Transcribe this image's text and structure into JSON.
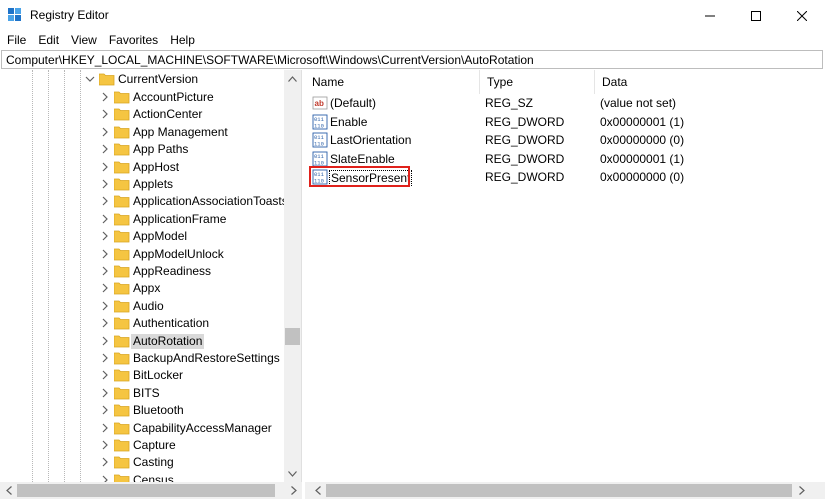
{
  "window": {
    "title": "Registry Editor",
    "icon": "registry-editor-icon"
  },
  "menu": [
    "File",
    "Edit",
    "View",
    "Favorites",
    "Help"
  ],
  "address": "Computer\\HKEY_LOCAL_MACHINE\\SOFTWARE\\Microsoft\\Windows\\CurrentVersion\\AutoRotation",
  "tree": {
    "parent": "CurrentVersion",
    "items": [
      "AccountPicture",
      "ActionCenter",
      "App Management",
      "App Paths",
      "AppHost",
      "Applets",
      "ApplicationAssociationToasts",
      "ApplicationFrame",
      "AppModel",
      "AppModelUnlock",
      "AppReadiness",
      "Appx",
      "Audio",
      "Authentication",
      "AutoRotation",
      "BackupAndRestoreSettings",
      "BitLocker",
      "BITS",
      "Bluetooth",
      "CapabilityAccessManager",
      "Capture",
      "Casting",
      "Census"
    ],
    "selected": "AutoRotation"
  },
  "values": {
    "columns": [
      "Name",
      "Type",
      "Data"
    ],
    "rows": [
      {
        "name": "(Default)",
        "type": "REG_SZ",
        "data": "(value not set)",
        "icon": "string-value-icon"
      },
      {
        "name": "Enable",
        "type": "REG_DWORD",
        "data": "0x00000001 (1)",
        "icon": "dword-value-icon"
      },
      {
        "name": "LastOrientation",
        "type": "REG_DWORD",
        "data": "0x00000000 (0)",
        "icon": "dword-value-icon"
      },
      {
        "name": "SlateEnable",
        "type": "REG_DWORD",
        "data": "0x00000001 (1)",
        "icon": "dword-value-icon"
      },
      {
        "name": "SensorPresent",
        "type": "REG_DWORD",
        "data": "0x00000000 (0)",
        "icon": "dword-value-icon"
      }
    ],
    "highlighted": "SensorPresent"
  },
  "colors": {
    "folder": "#f5c542",
    "selection": "#d9d9d9",
    "highlight_box": "#e0211b",
    "scrollbar_thumb": "#c1c1c1"
  }
}
